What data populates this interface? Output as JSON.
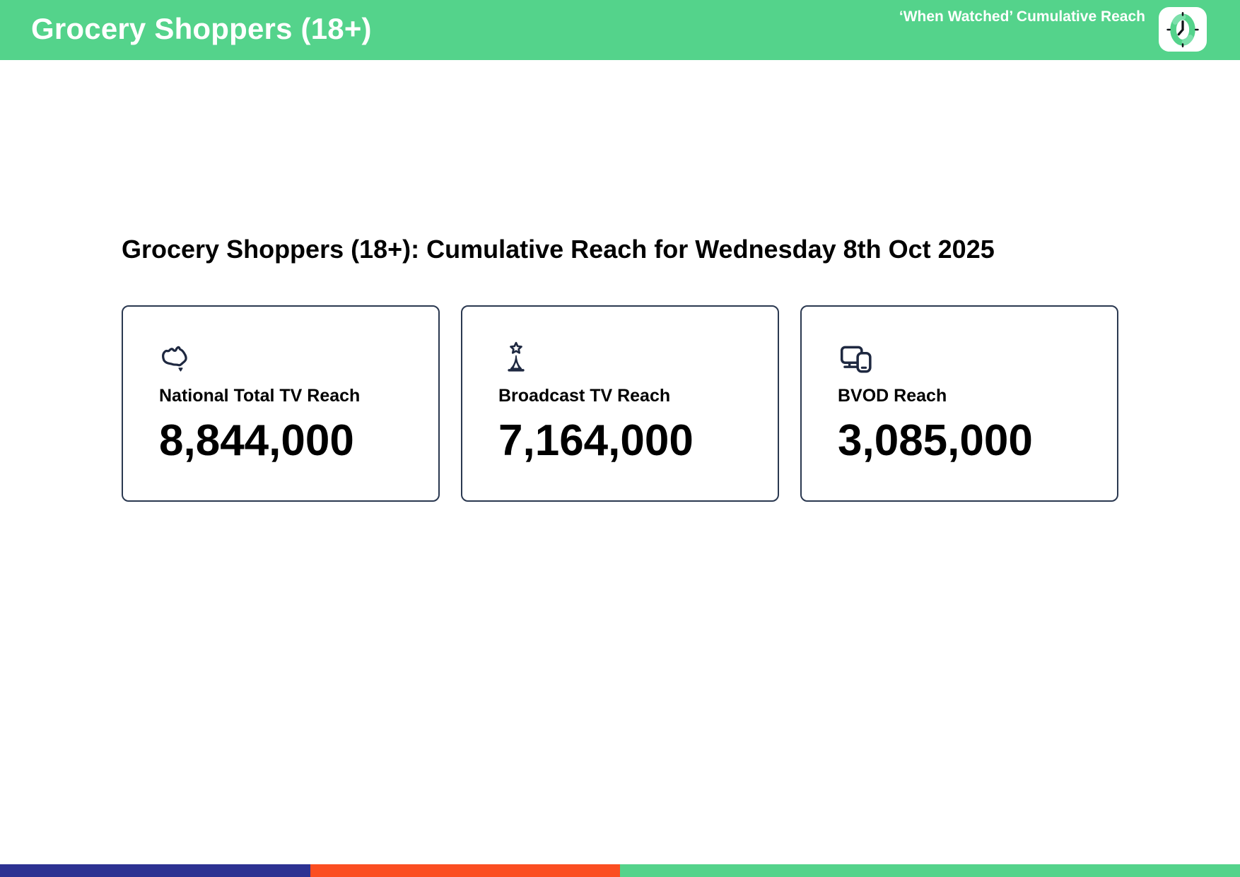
{
  "header": {
    "title": "Grocery Shoppers (18+)",
    "right_label": "‘When Watched’ Cumulative Reach",
    "badge_icon": "clock-icon"
  },
  "main": {
    "heading": "Grocery Shoppers (18+): Cumulative Reach for Wednesday 8th Oct 2025",
    "cards": [
      {
        "icon": "australia-map-icon",
        "label": "National Total TV Reach",
        "value": "8,844,000"
      },
      {
        "icon": "broadcast-tower-icon",
        "label": "Broadcast TV Reach",
        "value": "7,164,000"
      },
      {
        "icon": "devices-icon",
        "label": "BVOD Reach",
        "value": "3,085,000"
      }
    ]
  },
  "footer": {
    "segments": [
      {
        "name": "blue",
        "color": "#2d3292",
        "width_pct": 25
      },
      {
        "name": "orange",
        "color": "#fb4e21",
        "width_pct": 25
      },
      {
        "name": "green",
        "color": "#54d38b",
        "width_pct": 50
      }
    ]
  },
  "colors": {
    "brand_green": "#54d38b",
    "brand_green_light": "#7ce0ab",
    "navy": "#1e2840",
    "card_border": "#2a3850",
    "footer_blue": "#2d3292",
    "footer_orange": "#fb4e21",
    "text_black": "#000000",
    "white": "#ffffff"
  }
}
